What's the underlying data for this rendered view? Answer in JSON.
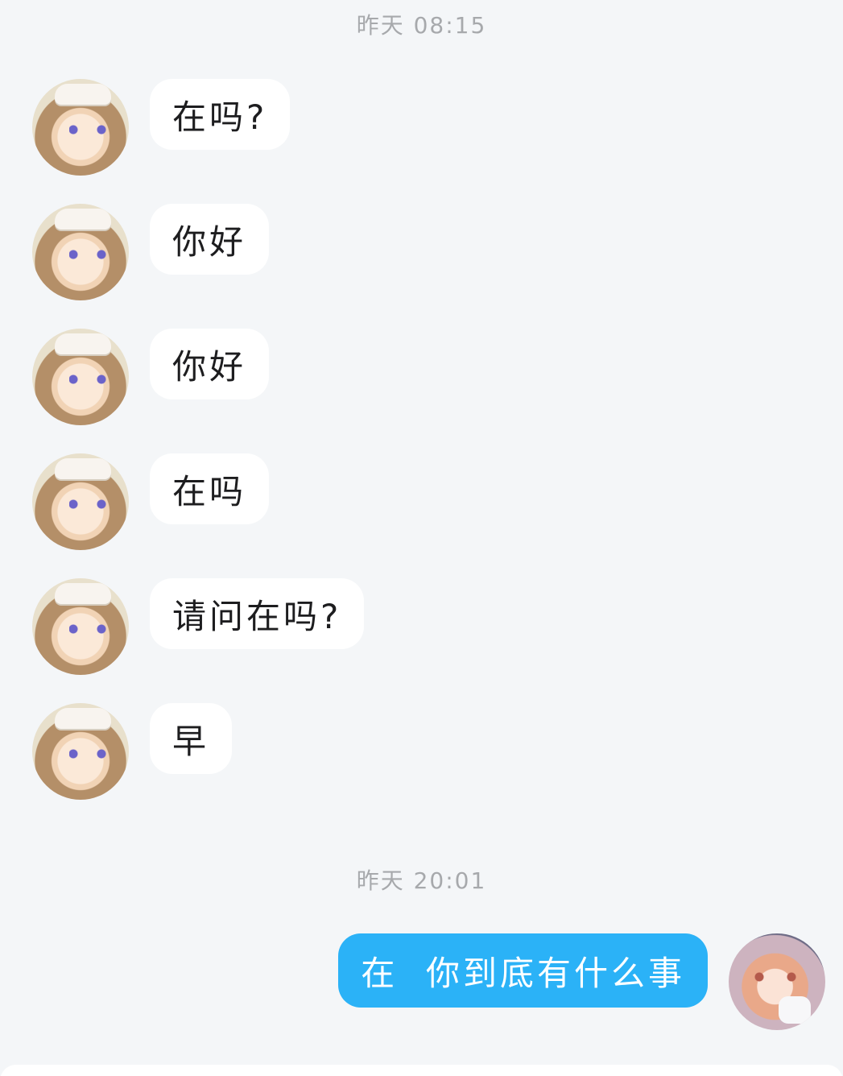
{
  "timestamps": [
    "昨天 08:15",
    "昨天 20:01"
  ],
  "incoming_messages": [
    {
      "text": "在吗?"
    },
    {
      "text": "你好"
    },
    {
      "text": "你好"
    },
    {
      "text": "在吗"
    },
    {
      "text": "请问在吗?"
    },
    {
      "text": "早"
    }
  ],
  "outgoing_messages": [
    {
      "text": "在  你到底有什么事"
    }
  ],
  "colors": {
    "background": "#f4f6f8",
    "incoming_bubble": "#ffffff",
    "outgoing_bubble": "#2bb2f7",
    "timestamp_text": "#a7a9ac"
  }
}
